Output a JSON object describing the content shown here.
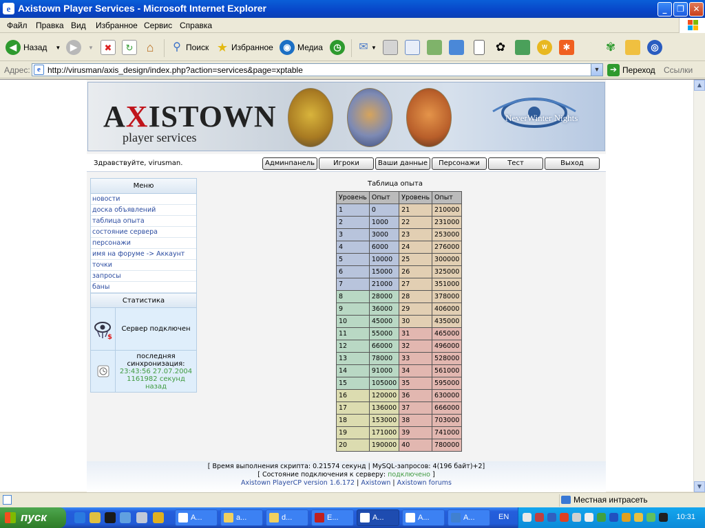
{
  "window": {
    "title": "Axistown Player Services - Microsoft Internet Explorer"
  },
  "menubar": [
    "Файл",
    "Правка",
    "Вид",
    "Избранное",
    "Сервис",
    "Справка"
  ],
  "toolbar": {
    "back": "Назад",
    "search": "Поиск",
    "favorites": "Избранное",
    "media": "Медиа"
  },
  "address": {
    "label": "Адрес:",
    "url": "http://virusman/axis_design/index.php?action=services&page=xptable",
    "go": "Переход",
    "links": "Ссылки"
  },
  "site": {
    "logo_main_a": "A",
    "logo_main_x": "X",
    "logo_main_rest": "ISTOWN",
    "logo_sub": "player services",
    "nwn_logo": "NeverWinter Nights",
    "greeting": "Здравствуйте, virusman.",
    "nav": [
      "Админпанель",
      "Игроки",
      "Ваши данные",
      "Персонажи",
      "Тест",
      "Выход"
    ]
  },
  "sidebar": {
    "menu_header": "Меню",
    "menu": [
      "новости",
      "доска объявлений",
      "таблица опыта",
      "состояние сервера",
      "персонажи",
      "имя на форуме -> Аккаунт",
      "точки",
      "запросы",
      "баны"
    ],
    "stats_header": "Статистика",
    "server_status": "Сервер подключен",
    "sync_label": "последняя синхронизация:",
    "sync_time": "23:43:56 27.07.2004",
    "sync_ago": "1161982 секунд назад"
  },
  "xptable": {
    "title": "Таблица опыта",
    "headers": [
      "Уровень",
      "Опыт",
      "Уровень",
      "Опыт"
    ],
    "rows": [
      [
        "1",
        "0",
        "21",
        "210000"
      ],
      [
        "2",
        "1000",
        "22",
        "231000"
      ],
      [
        "3",
        "3000",
        "23",
        "253000"
      ],
      [
        "4",
        "6000",
        "24",
        "276000"
      ],
      [
        "5",
        "10000",
        "25",
        "300000"
      ],
      [
        "6",
        "15000",
        "26",
        "325000"
      ],
      [
        "7",
        "21000",
        "27",
        "351000"
      ],
      [
        "8",
        "28000",
        "28",
        "378000"
      ],
      [
        "9",
        "36000",
        "29",
        "406000"
      ],
      [
        "10",
        "45000",
        "30",
        "435000"
      ],
      [
        "11",
        "55000",
        "31",
        "465000"
      ],
      [
        "12",
        "66000",
        "32",
        "496000"
      ],
      [
        "13",
        "78000",
        "33",
        "528000"
      ],
      [
        "14",
        "91000",
        "34",
        "561000"
      ],
      [
        "15",
        "105000",
        "35",
        "595000"
      ],
      [
        "16",
        "120000",
        "36",
        "630000"
      ],
      [
        "17",
        "136000",
        "37",
        "666000"
      ],
      [
        "18",
        "153000",
        "38",
        "703000"
      ],
      [
        "19",
        "171000",
        "39",
        "741000"
      ],
      [
        "20",
        "190000",
        "40",
        "780000"
      ]
    ]
  },
  "footer": {
    "line1": "[ Время выполнения скрипта: 0.21574 секунд | MySQL-запросов: 4(196 байт)+2]",
    "line2_pre": "[ Состояние подключения к серверу: ",
    "line2_status": "подключено",
    "line2_post": " ]",
    "link1": "Axistown PlayerCP version 1.6.172",
    "sep": " | ",
    "link2": "Axistown",
    "link3": "Axistown forums"
  },
  "statusbar": {
    "zone": "Местная интрасеть"
  },
  "taskbar": {
    "start": "пуск",
    "tasks": [
      "A...",
      "a...",
      "d...",
      "E...",
      "A...",
      "A...",
      "A..."
    ],
    "lang": "EN",
    "clock": "10:31"
  }
}
